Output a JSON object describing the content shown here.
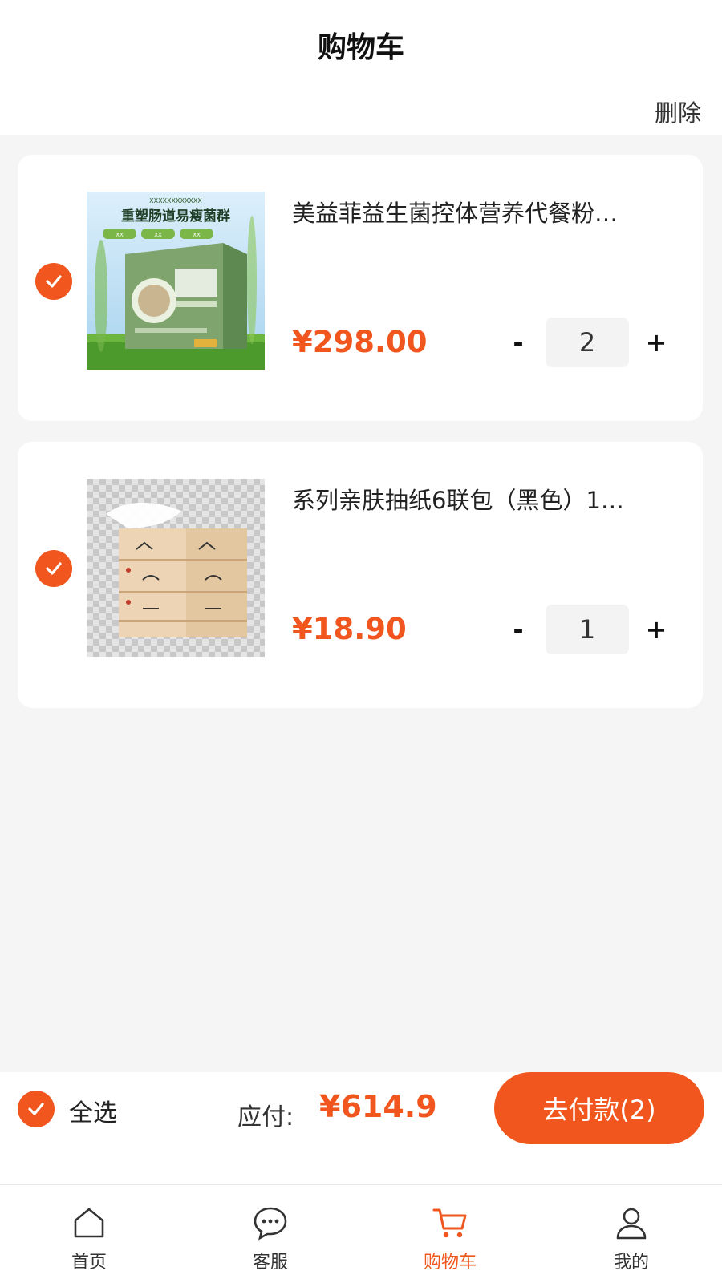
{
  "header": {
    "title": "购物车",
    "delete_label": "删除"
  },
  "cart": {
    "items": [
      {
        "name": "美益菲益生菌控体营养代餐粉…",
        "price": "¥298.00",
        "quantity": "2",
        "selected": true,
        "image": {
          "top_text": "XXXXXXXXXXXX",
          "headline": "重塑肠道易瘦菌群",
          "tags": [
            "XX",
            "XX",
            "XX"
          ]
        }
      },
      {
        "name": "系列亲肤抽纸6联包（黑色）1…",
        "price": "¥18.90",
        "quantity": "1",
        "selected": true
      }
    ],
    "minus_label": "-",
    "plus_label": "+"
  },
  "checkout": {
    "select_all_label": "全选",
    "total_label": "应付:",
    "total_value": "¥614.9",
    "pay_button_label": "去付款(2)"
  },
  "tabbar": {
    "items": [
      {
        "label": "首页",
        "icon": "home-icon",
        "active": false
      },
      {
        "label": "客服",
        "icon": "chat-icon",
        "active": false
      },
      {
        "label": "购物车",
        "icon": "cart-icon",
        "active": true
      },
      {
        "label": "我的",
        "icon": "user-icon",
        "active": false
      }
    ]
  },
  "colors": {
    "accent": "#f0561d",
    "background": "#f5f5f5",
    "card": "#ffffff"
  }
}
